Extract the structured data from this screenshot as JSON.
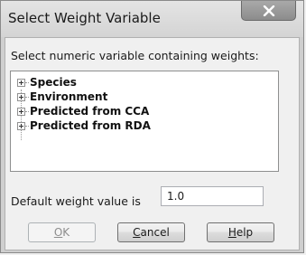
{
  "window": {
    "title": "Select Weight Variable",
    "close_glyph": "X"
  },
  "prompt": "Select numeric variable containing weights:",
  "tree": {
    "items": [
      {
        "label": "Species",
        "expander": "plus-icon"
      },
      {
        "label": "Environment",
        "expander": "plus-icon"
      },
      {
        "label": "Predicted from CCA",
        "expander": "plus-icon"
      },
      {
        "label": "Predicted from RDA",
        "expander": "plus-icon"
      }
    ]
  },
  "default_weight": {
    "label": "Default weight value is",
    "value": "1.0"
  },
  "buttons": {
    "ok": {
      "mnemonic": "O",
      "rest": "K",
      "enabled": false
    },
    "cancel": {
      "mnemonic": "C",
      "rest": "ancel",
      "enabled": true
    },
    "help": {
      "mnemonic": "H",
      "rest": "elp",
      "enabled": true
    }
  }
}
